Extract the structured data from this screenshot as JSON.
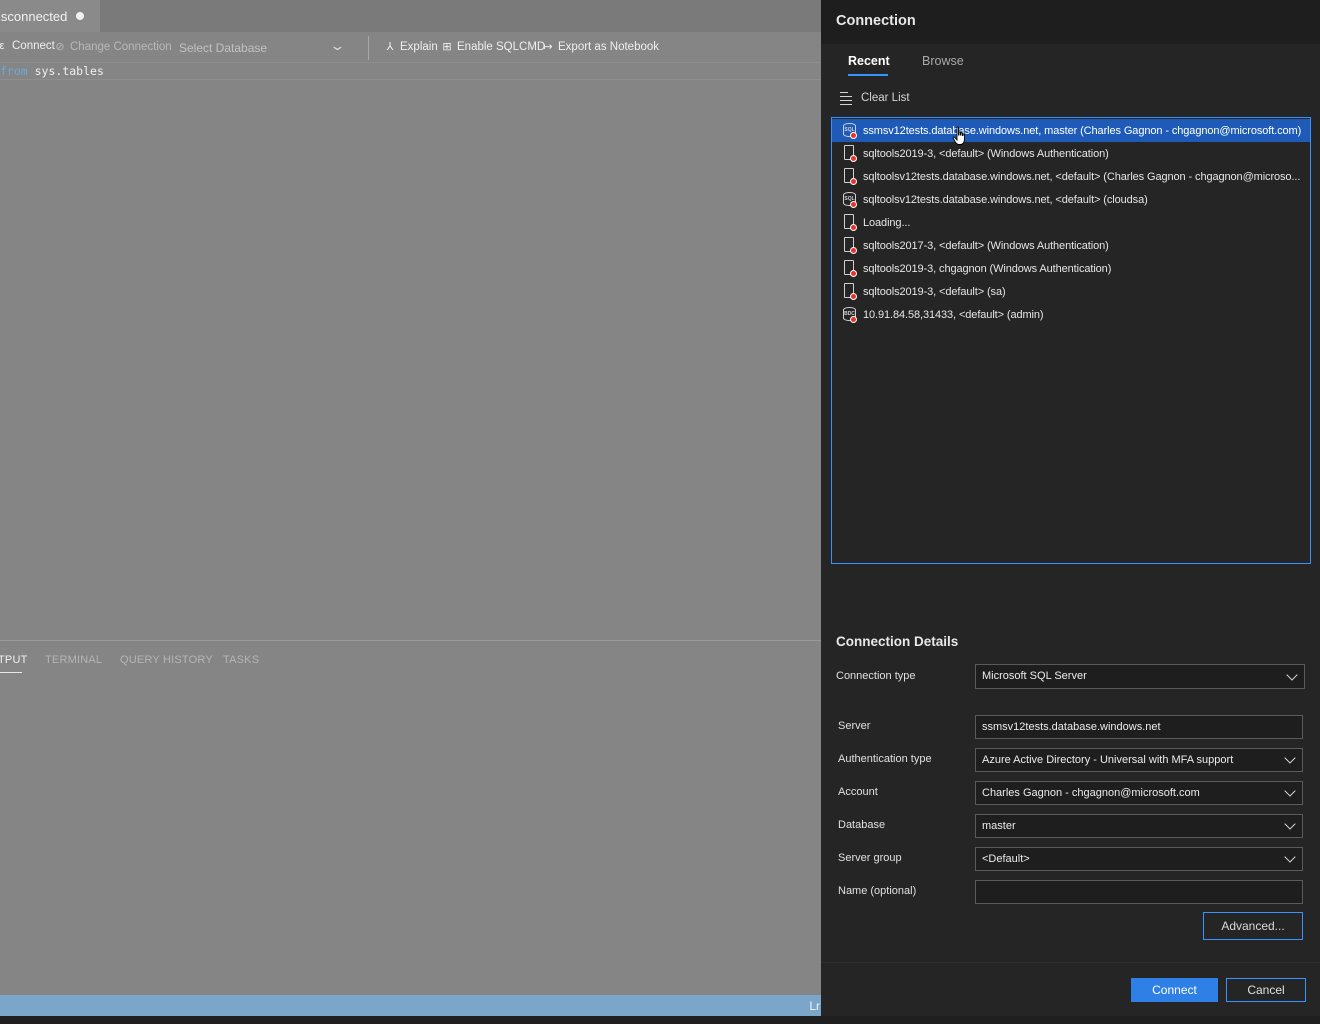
{
  "editor": {
    "tab_title": "isconnected",
    "toolbar": {
      "connect": "Connect",
      "change_connection": "Change Connection",
      "select_database": "Select Database",
      "explain": "Explain",
      "enable_sqlcmd": "Enable SQLCMD",
      "export_notebook": "Export as Notebook"
    },
    "code": {
      "keyword": "from",
      "rest": " sys.tables"
    },
    "panel_tabs": [
      "TPUT",
      "TERMINAL",
      "QUERY HISTORY",
      "TASKS"
    ],
    "status_text": "Lr"
  },
  "dialog": {
    "title": "Connection",
    "tabs": {
      "recent": "Recent",
      "browse": "Browse"
    },
    "clear_list": "Clear List",
    "recent": [
      {
        "label": "ssmsv12tests.database.windows.net, master (Charles Gagnon - chgagnon@microsoft.com)",
        "icon": "azure-sql-icon",
        "selected": true
      },
      {
        "label": "sqltools2019-3, <default> (Windows Authentication)",
        "icon": "server-icon"
      },
      {
        "label": "sqltoolsv12tests.database.windows.net, <default> (Charles Gagnon - chgagnon@microso...",
        "icon": "server-icon"
      },
      {
        "label": "sqltoolsv12tests.database.windows.net, <default> (cloudsa)",
        "icon": "azure-sql-icon"
      },
      {
        "label": "Loading...",
        "icon": "server-icon"
      },
      {
        "label": "sqltools2017-3, <default> (Windows Authentication)",
        "icon": "server-icon"
      },
      {
        "label": "sqltools2019-3, chgagnon (Windows Authentication)",
        "icon": "server-icon"
      },
      {
        "label": "sqltools2019-3, <default> (sa)",
        "icon": "server-icon"
      },
      {
        "label": "10.91.84.58,31433, <default> (admin)",
        "icon": "big-data-cluster-icon"
      }
    ],
    "details": {
      "title": "Connection Details",
      "connection_type_label": "Connection type",
      "connection_type": "Microsoft SQL Server",
      "server_label": "Server",
      "server": "ssmsv12tests.database.windows.net",
      "auth_label": "Authentication type",
      "auth": "Azure Active Directory - Universal with MFA support",
      "account_label": "Account",
      "account": "Charles Gagnon - chgagnon@microsoft.com",
      "database_label": "Database",
      "database": "master",
      "server_group_label": "Server group",
      "server_group": "<Default>",
      "name_label": "Name (optional)",
      "name": ""
    },
    "buttons": {
      "advanced": "Advanced...",
      "connect": "Connect",
      "cancel": "Cancel"
    }
  },
  "colors": {
    "accent": "#3794ff",
    "selection": "#1e5bb8",
    "primary_button": "#2f80e6",
    "error_badge": "#e5342a"
  }
}
